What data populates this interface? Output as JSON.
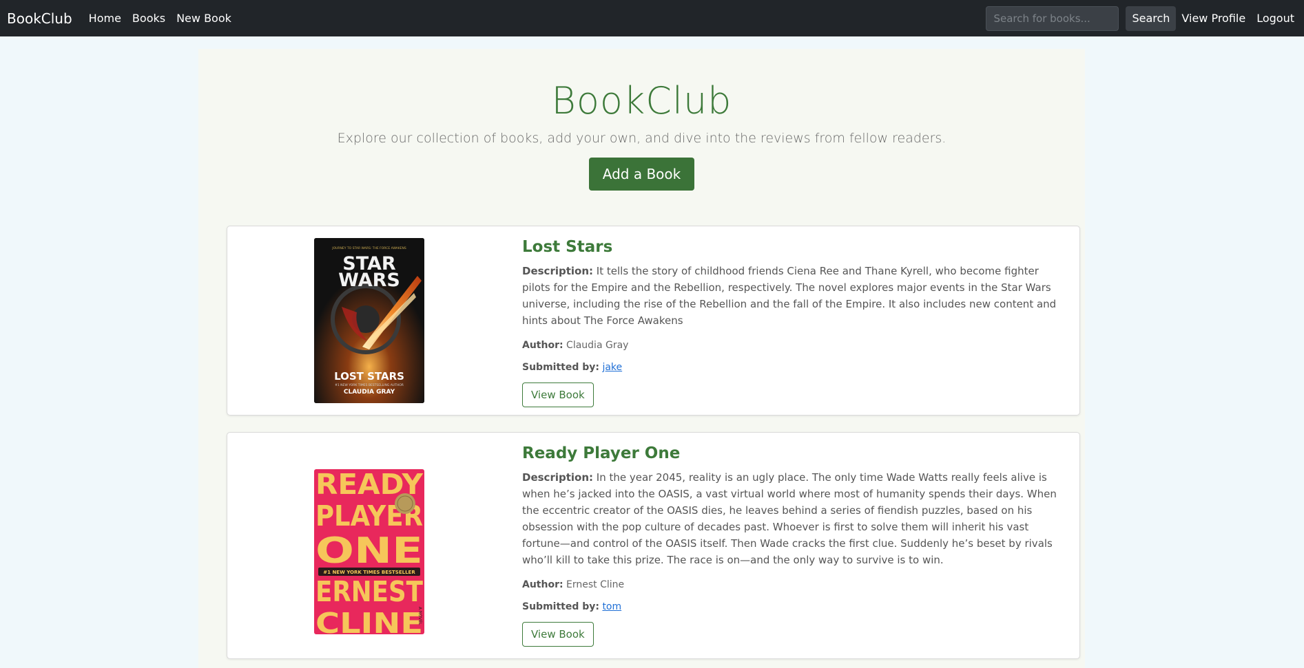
{
  "navbar": {
    "brand": "BookClub",
    "links": [
      "Home",
      "Books",
      "New Book"
    ],
    "search_placeholder": "Search for books...",
    "search_button": "Search",
    "profile_link": "View Profile",
    "logout_link": "Logout"
  },
  "hero": {
    "title": "BookClub",
    "subtitle": "Explore our collection of books, add your own, and dive into the reviews from fellow readers.",
    "add_button": "Add a Book"
  },
  "labels": {
    "description": "Description:",
    "author": "Author:",
    "submitted_by": "Submitted by:",
    "view_button": "View Book"
  },
  "books": [
    {
      "title": "Lost Stars",
      "description": "It tells the story of childhood friends Ciena Ree and Thane Kyrell, who become fighter pilots for the Empire and the Rebellion, respectively. The novel explores major events in the Star Wars universe, including the rise of the Rebellion and the fall of the Empire. It also includes new content and hints about The Force Awakens",
      "author": "Claudia Gray",
      "submitted_by": "jake",
      "cover": {
        "top_line": "JOURNEY TO STAR WARS: THE FORCE AWAKENS",
        "logo_line1": "STAR",
        "logo_line2": "WARS",
        "title": "LOST STARS",
        "tagline": "#1 NEW YORK TIMES BESTSELLING AUTHOR",
        "author": "CLAUDIA GRAY",
        "bg": "#111111",
        "accent": "#e8702a"
      }
    },
    {
      "title": "Ready Player One",
      "description": "In the year 2045, reality is an ugly place. The only time Wade Watts really feels alive is when he’s jacked into the OASIS, a vast virtual world where most of humanity spends their days. When the eccentric creator of the OASIS dies, he leaves behind a series of fiendish puzzles, based on his obsession with the pop culture of decades past. Whoever is first to solve them will inherit his vast fortune—and control of the OASIS itself. Then Wade cracks the first clue. Suddenly he’s beset by rivals who’ll kill to take this prize. The race is on—and the only way to survive is to win.",
      "author": "Ernest Cline",
      "submitted_by": "tom",
      "cover": {
        "lines": [
          "READY",
          "PLAYER",
          "ONE",
          "ERNEST",
          "CLINE"
        ],
        "banner": "#1 NEW YORK TIMES BESTSELLER",
        "side_text": "A NOVEL",
        "bg": "#e8285c",
        "text_color": "#f6c65a"
      }
    }
  ]
}
